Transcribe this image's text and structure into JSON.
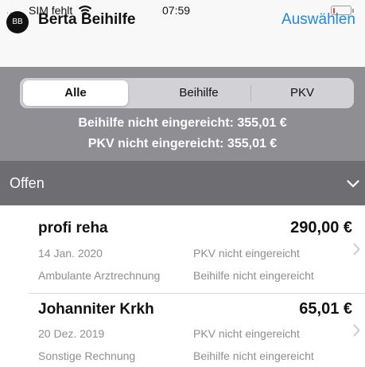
{
  "status_bar": {
    "signal_dots": "....",
    "carrier": "SIM fehlt",
    "wifi_icon": "wifi-icon",
    "time": "07:59",
    "battery_level": 0.05,
    "battery_color": "#ff3b30"
  },
  "nav": {
    "avatar_initials": "BB",
    "title": "Berta Beihilfe",
    "action_label": "Auswählen",
    "accent_color": "#1e88e5"
  },
  "filter": {
    "segments": [
      {
        "label": "Alle",
        "selected": true
      },
      {
        "label": "Beihilfe",
        "selected": false
      },
      {
        "label": "PKV",
        "selected": false
      }
    ],
    "summary_beihilfe": "Beihilfe nicht eingereicht: 355,01 €",
    "summary_pkv": "PKV nicht eingereicht: 355,01 €"
  },
  "section": {
    "title": "Offen",
    "expanded_icon": "chevron-down-icon"
  },
  "invoices": [
    {
      "name": "profi reha",
      "amount": "290,00 €",
      "date": "14 Jan. 2020",
      "pkv_status": "PKV nicht eingereicht",
      "type": "Ambulante Arztrechnung",
      "beihilfe_status": "Beihilfe nicht eingereicht"
    },
    {
      "name": "Johanniter Krkh",
      "amount": "65,01 €",
      "date": "20 Dez. 2019",
      "pkv_status": "PKV nicht eingereicht",
      "type": "Sonstige Rechnung",
      "beihilfe_status": "Beihilfe nicht eingereicht"
    }
  ]
}
